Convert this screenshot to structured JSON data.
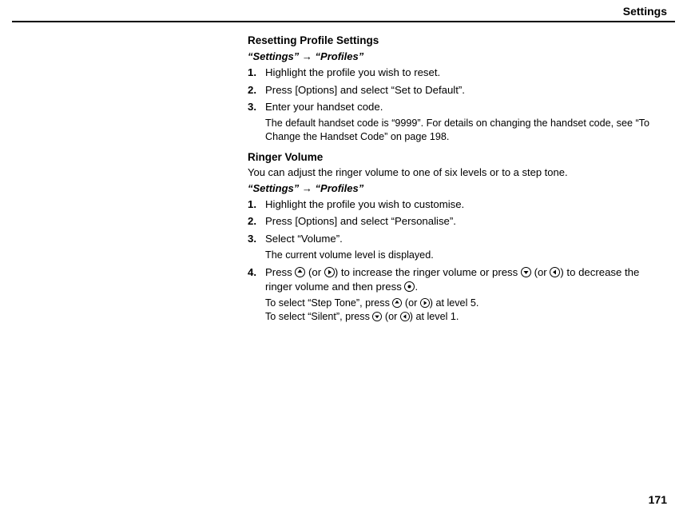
{
  "header": "Settings",
  "page_number": "171",
  "section1": {
    "title": "Resetting Profile Settings",
    "breadcrumb_a": "“Settings”",
    "breadcrumb_arrow": " → ",
    "breadcrumb_b": "“Profiles”",
    "steps": [
      {
        "num": "1.",
        "text": "Highlight the profile you wish to reset."
      },
      {
        "num": "2.",
        "text": "Press [Options] and select “Set to Default”."
      },
      {
        "num": "3.",
        "text": "Enter your handset code.",
        "note": "The default handset code is “9999”. For details on changing the handset code, see “To Change the Handset Code” on page 198."
      }
    ]
  },
  "section2": {
    "title": "Ringer Volume",
    "intro": "You can adjust the ringer volume to one of six levels or to a step tone.",
    "breadcrumb_a": "“Settings”",
    "breadcrumb_arrow": " → ",
    "breadcrumb_b": "“Profiles”",
    "steps": [
      {
        "num": "1.",
        "text": "Highlight the profile you wish to customise."
      },
      {
        "num": "2.",
        "text": "Press [Options] and select “Personalise”."
      },
      {
        "num": "3.",
        "text": "Select “Volume”.",
        "note": "The current volume level is displayed."
      }
    ],
    "step4": {
      "num": "4.",
      "t1": "Press ",
      "t2": " (or ",
      "t3": ") to increase the ringer volume or press ",
      "t4": " (or ",
      "t5": ") to decrease the ringer volume and then press ",
      "t6": ".",
      "n1": "To select “Step Tone”, press ",
      "n2": " (or ",
      "n3": ") at level 5.",
      "n4": "To select “Silent”, press ",
      "n5": " (or ",
      "n6": ") at level 1."
    }
  }
}
